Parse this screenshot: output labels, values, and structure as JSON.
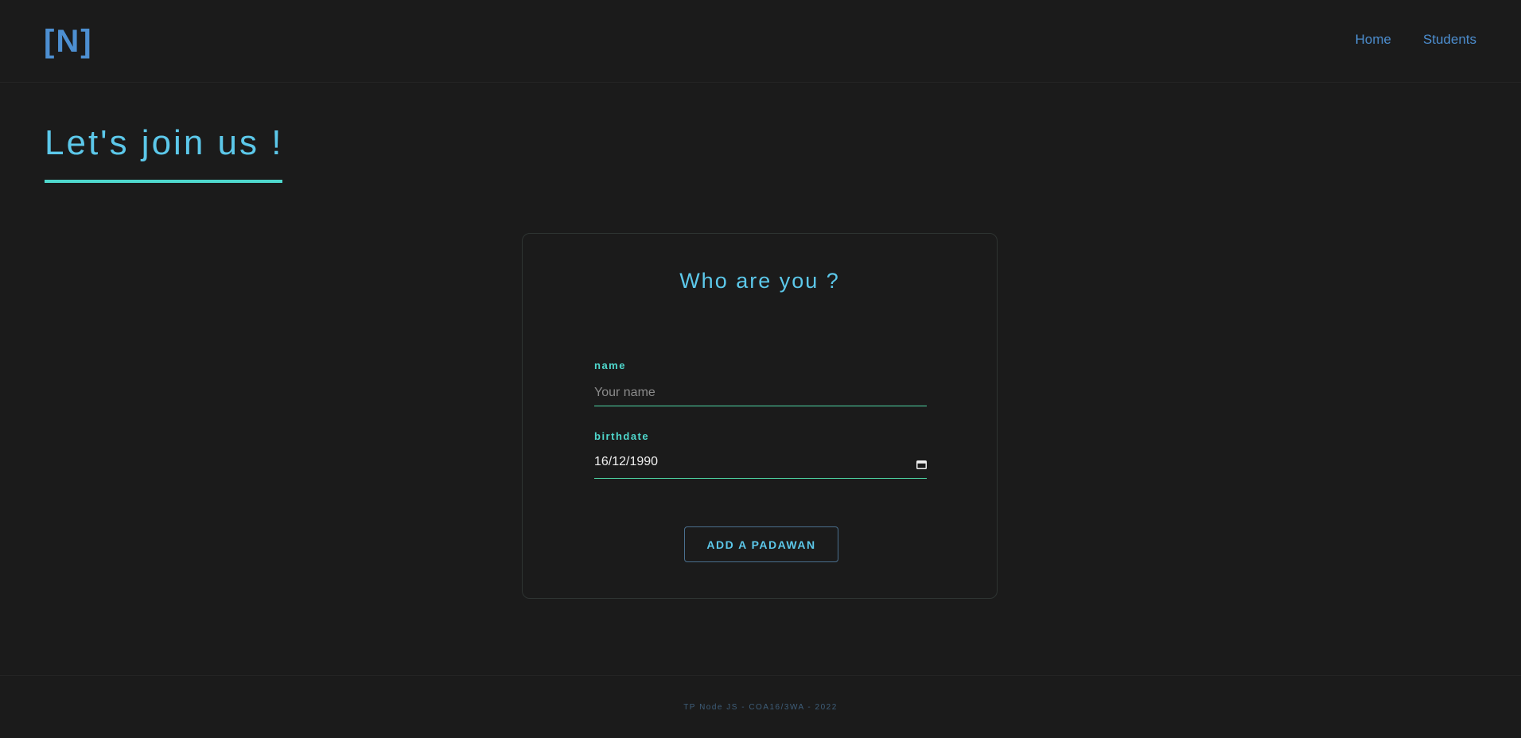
{
  "header": {
    "logo": "[N]",
    "nav": [
      {
        "label": "Home"
      },
      {
        "label": "Students"
      }
    ]
  },
  "main": {
    "title": "Let's join us !"
  },
  "form": {
    "title": "Who are you ?",
    "name": {
      "label": "name",
      "placeholder": "Your name",
      "value": ""
    },
    "birthdate": {
      "label": "birthdate",
      "value": "16/12/1990",
      "icon": "calendar-icon"
    },
    "submit_label": "ADD A PADAWAN"
  },
  "footer": {
    "text": "TP Node JS - COA16/3WA - 2022"
  },
  "colors": {
    "background": "#1b1b1b",
    "accent_blue": "#4d8fd1",
    "accent_cyan": "#5cc8ea",
    "accent_teal": "#4fd8cd"
  }
}
